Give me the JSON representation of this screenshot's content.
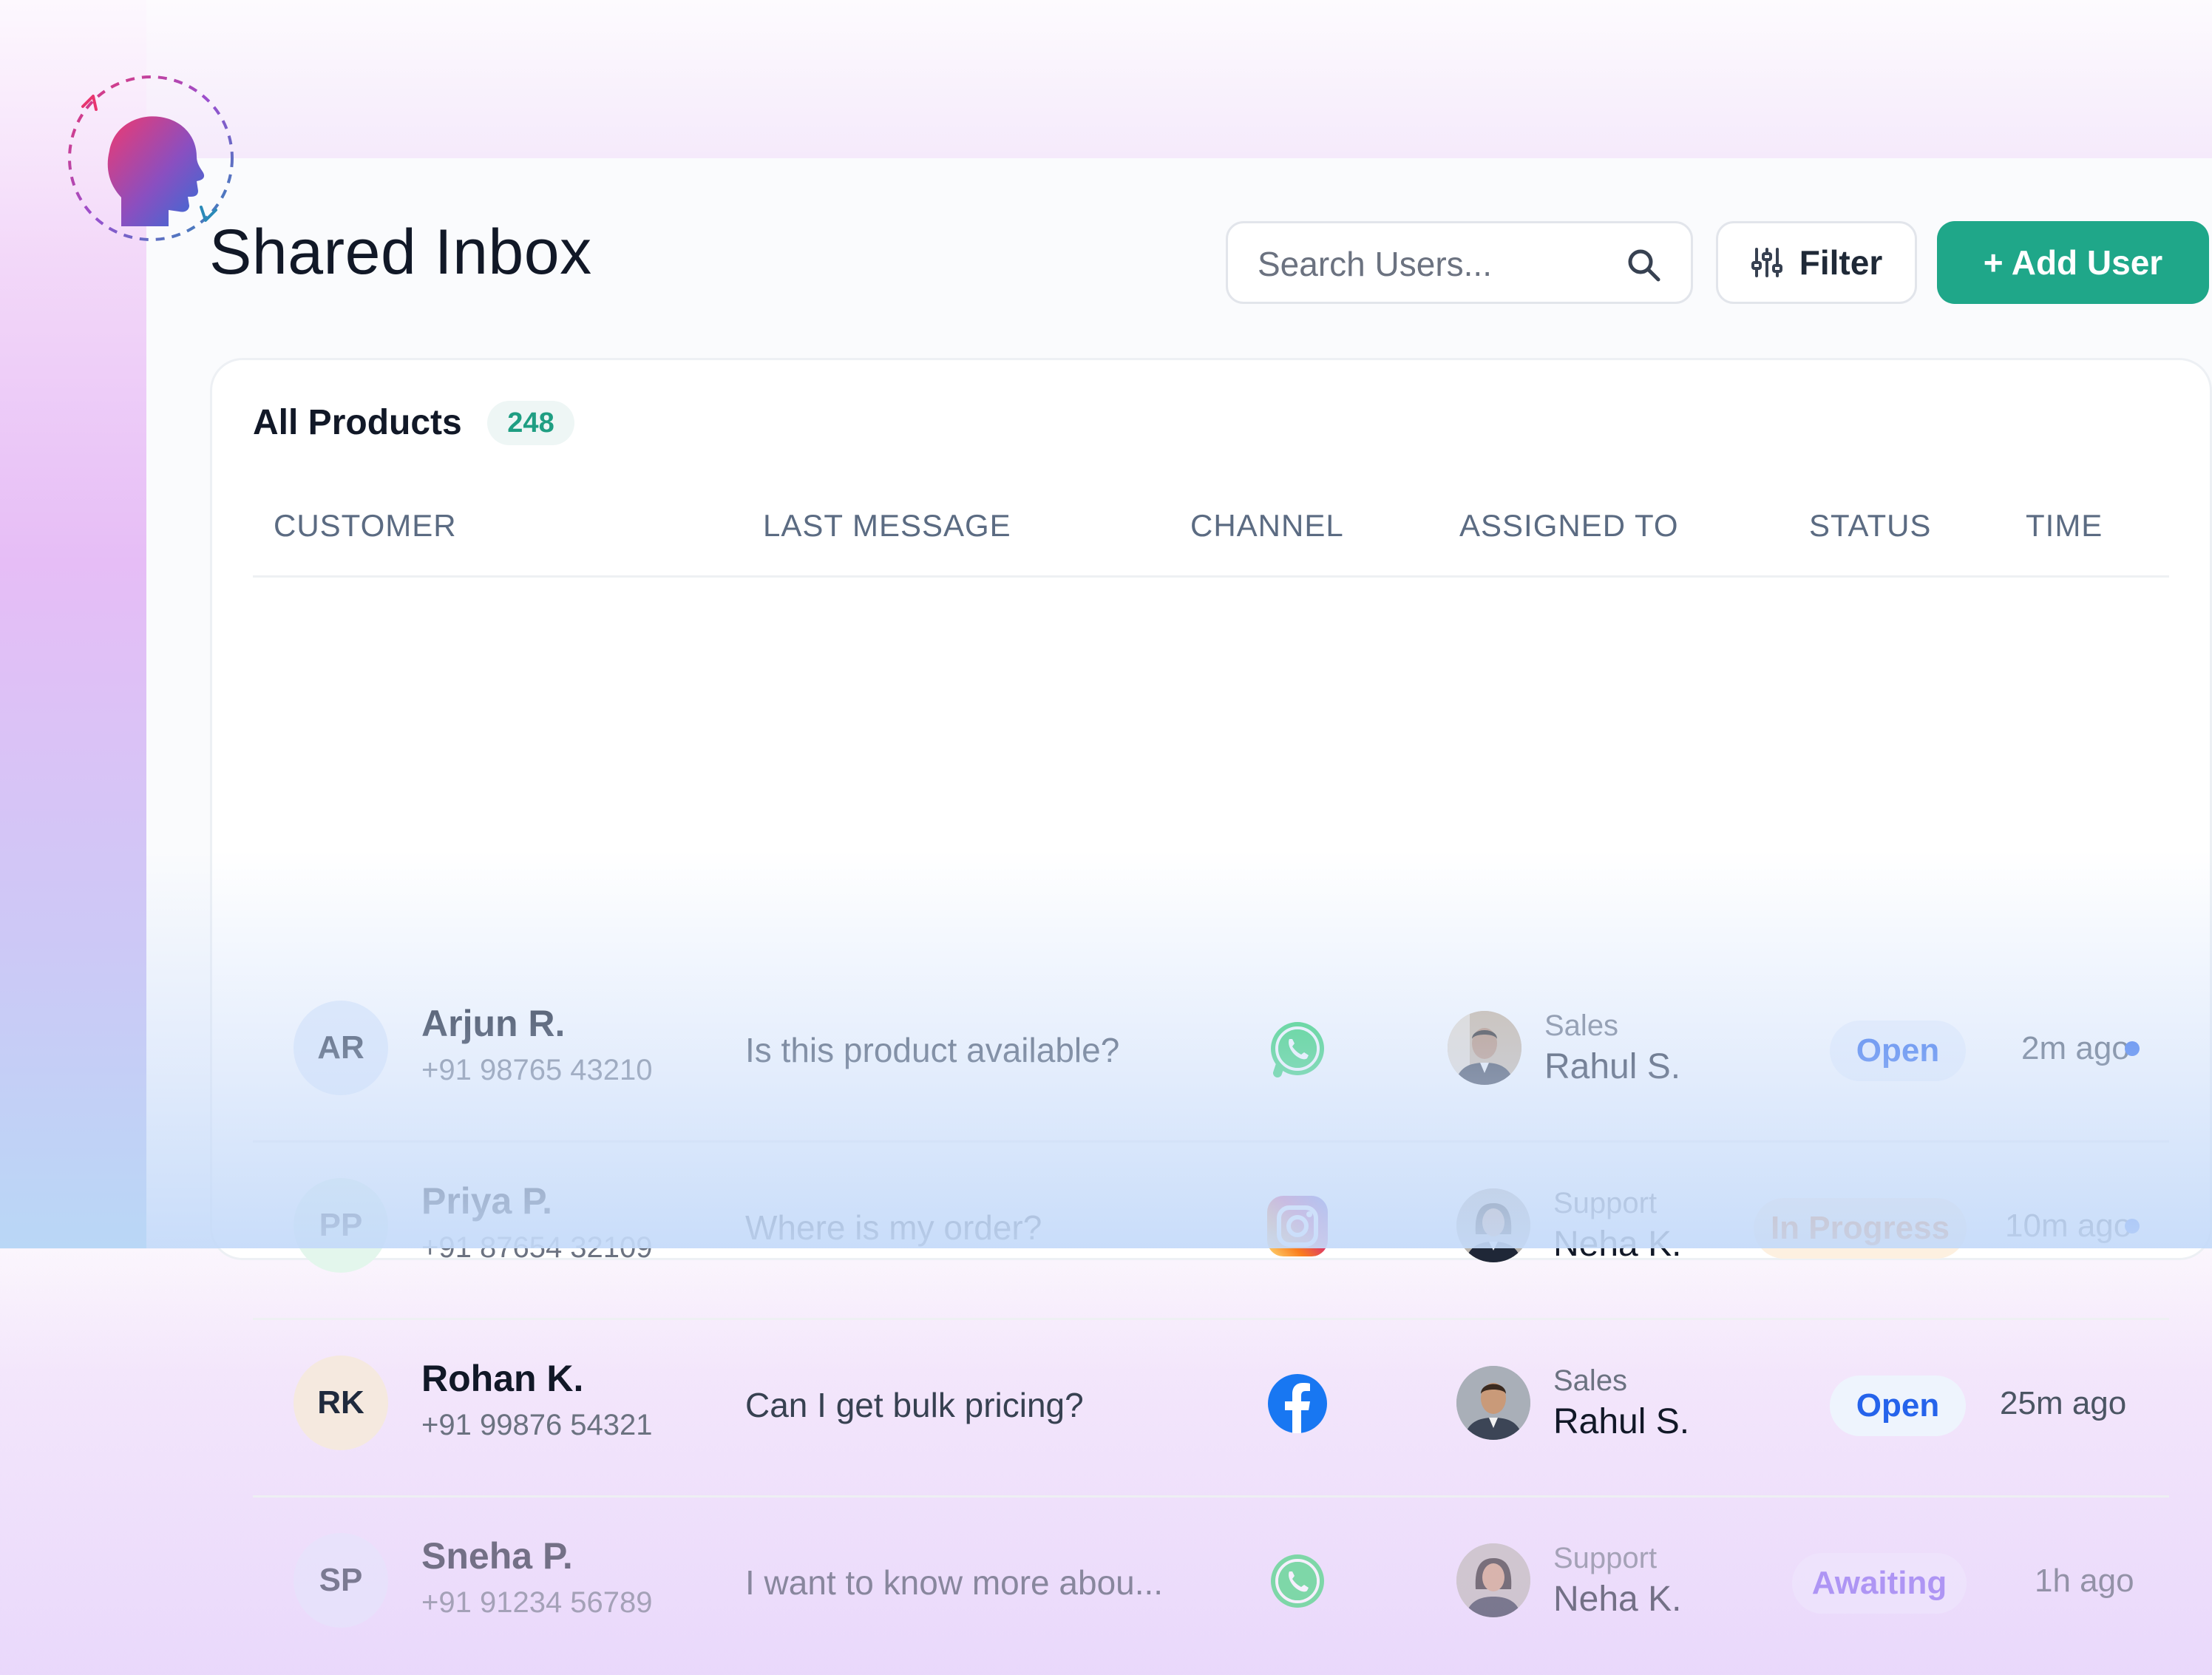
{
  "header": {
    "title": "Shared Inbox",
    "search_placeholder": "Search Users...",
    "filter_label": "Filter",
    "add_user_label": "+ Add User"
  },
  "card": {
    "title": "All Products",
    "count": "248",
    "columns": [
      "CUSTOMER",
      "LAST MESSAGE",
      "CHANNEL",
      "ASSIGNED TO",
      "STATUS",
      "TIME"
    ]
  },
  "rows": [
    {
      "initials": "AR",
      "name": "Arjun R.",
      "phone": "+91 98765 43210",
      "message": "Is this product available?",
      "channel": "whatsapp-icon",
      "dept": "Sales",
      "agent": "Rahul S.",
      "status": "Open",
      "time": "2m ago",
      "unread": true
    },
    {
      "initials": "PP",
      "name": "Priya P.",
      "phone": "+91 87654 32109",
      "message": "Where is my order?",
      "channel": "instagram-icon",
      "dept": "Support",
      "agent": "Neha K.",
      "status": "In Progress",
      "time": "10m ago",
      "unread": true
    },
    {
      "initials": "RK",
      "name": "Rohan K.",
      "phone": "+91 99876 54321",
      "message": "Can I get bulk pricing?",
      "channel": "facebook-icon",
      "dept": "Sales",
      "agent": "Rahul S.",
      "status": "Open",
      "time": "25m ago",
      "unread": false
    },
    {
      "initials": "SP",
      "name": "Sneha P.",
      "phone": "+91 91234 56789",
      "message": "I want to know more abou...",
      "channel": "whatsapp-icon",
      "dept": "Support",
      "agent": "Neha K.",
      "status": "Awaiting",
      "time": "1h ago",
      "unread": false
    }
  ],
  "colors": {
    "accent": "#1fa789",
    "open_bg": "#eef4fd",
    "open_text": "#2563eb",
    "progress_bg": "#fdf0e0",
    "progress_text": "#e0620f",
    "awaiting_bg": "#efe8fd",
    "awaiting_text": "#7c5cf0",
    "unread_dot": "#2563eb"
  }
}
